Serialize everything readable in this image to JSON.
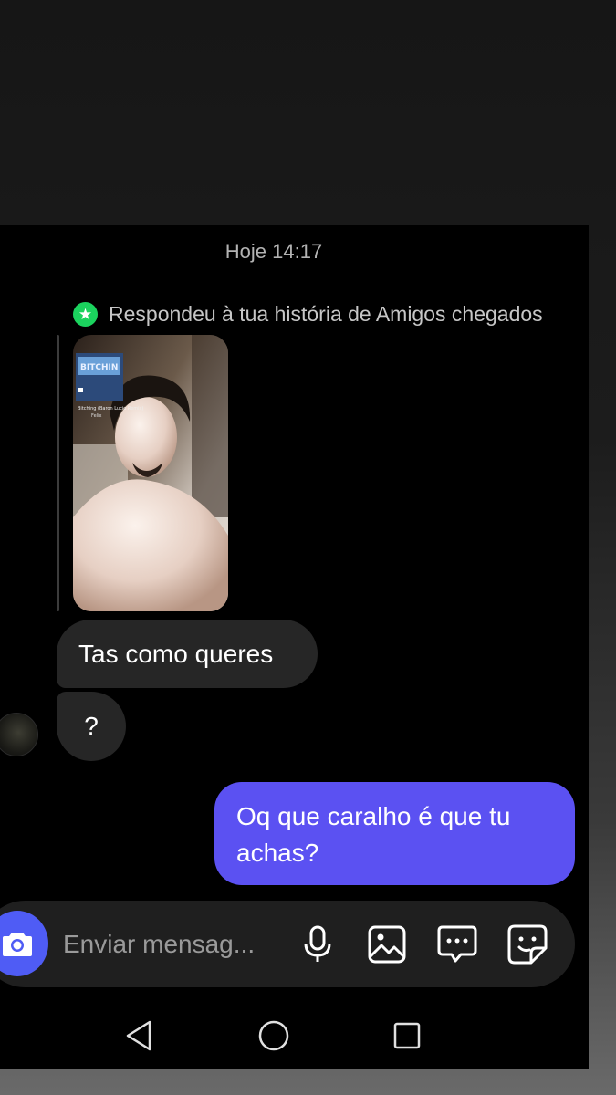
{
  "chat": {
    "date_label": "Hoje 14:17",
    "story_reply_label": "Respondeu à tua história de Amigos chegados",
    "story_music": {
      "title": "Bitching (Baron Lucio Remix)",
      "artist": "Felix"
    },
    "messages": [
      {
        "sender": "other",
        "text": "Tas como queres"
      },
      {
        "sender": "other",
        "text": "?"
      },
      {
        "sender": "me",
        "text": "Oq que caralho é que tu achas?"
      }
    ]
  },
  "composer": {
    "placeholder": "Enviar mensag..."
  },
  "colors": {
    "outgoing_bubble": "#5b51f2",
    "incoming_bubble": "#262626",
    "close_friends_badge": "#1bd35e",
    "camera_button": "#4f5cf5"
  },
  "icons": [
    "star-icon",
    "camera-icon",
    "microphone-icon",
    "gallery-icon",
    "chat-icon",
    "sticker-icon",
    "back-icon",
    "home-icon",
    "recents-icon"
  ]
}
